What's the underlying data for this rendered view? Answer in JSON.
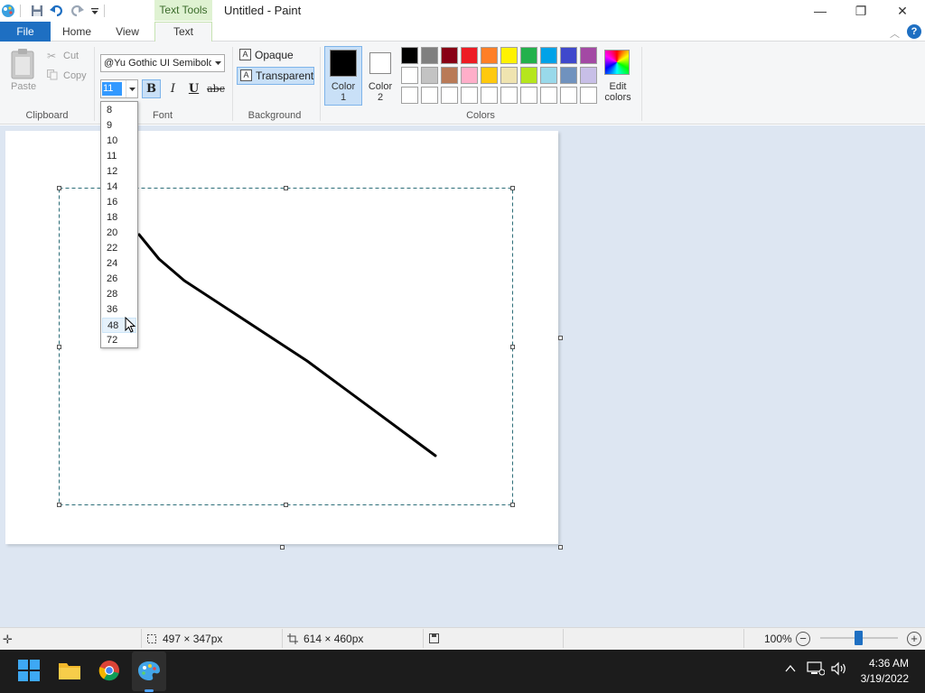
{
  "window": {
    "title": "Untitled - Paint",
    "context_tab_group": "Text Tools",
    "controls": {
      "minimize": "—",
      "maximize": "❐",
      "close": "✕"
    }
  },
  "tabs": {
    "file": "File",
    "home": "Home",
    "view": "View",
    "text": "Text"
  },
  "ribbon": {
    "clipboard": {
      "label": "Clipboard",
      "paste": "Paste",
      "cut": "Cut",
      "copy": "Copy"
    },
    "font": {
      "label": "Font",
      "family": "@Yu Gothic UI Semibold",
      "size": "11",
      "bold": "B",
      "italic": "I",
      "underline": "U",
      "strikethrough": "abc"
    },
    "background": {
      "label": "Background",
      "opaque": "Opaque",
      "transparent": "Transparent"
    },
    "colors": {
      "label": "Colors",
      "color1_line1": "Color",
      "color1_line2": "1",
      "color2_line1": "Color",
      "color2_line2": "2",
      "edit_line1": "Edit",
      "edit_line2": "colors",
      "color1_value": "#000000",
      "color2_value": "#ffffff",
      "palette_row1": [
        "#000000",
        "#7f7f7f",
        "#880015",
        "#ed1c24",
        "#ff7f27",
        "#fff200",
        "#22b14c",
        "#00a2e8",
        "#3f48cc",
        "#a349a4"
      ],
      "palette_row2": [
        "#ffffff",
        "#c3c3c3",
        "#b97a57",
        "#ffaec9",
        "#ffc90e",
        "#efe4b0",
        "#b5e61d",
        "#99d9ea",
        "#7092be",
        "#c8bfe7"
      ],
      "palette_row3": [
        "#ffffff",
        "#ffffff",
        "#ffffff",
        "#ffffff",
        "#ffffff",
        "#ffffff",
        "#ffffff",
        "#ffffff",
        "#ffffff",
        "#ffffff"
      ]
    }
  },
  "font_size_dropdown": {
    "options": [
      "8",
      "9",
      "10",
      "11",
      "12",
      "14",
      "16",
      "18",
      "20",
      "22",
      "24",
      "26",
      "28",
      "36",
      "48",
      "72"
    ],
    "hovered": "48"
  },
  "statusbar": {
    "selection_size": "497 × 347px",
    "canvas_size": "614 × 460px",
    "zoom": "100%"
  },
  "taskbar": {
    "time": "4:36 AM",
    "date": "3/19/2022",
    "icons": [
      "windows-start-icon",
      "file-explorer-icon",
      "chrome-icon",
      "paint-icon"
    ]
  }
}
